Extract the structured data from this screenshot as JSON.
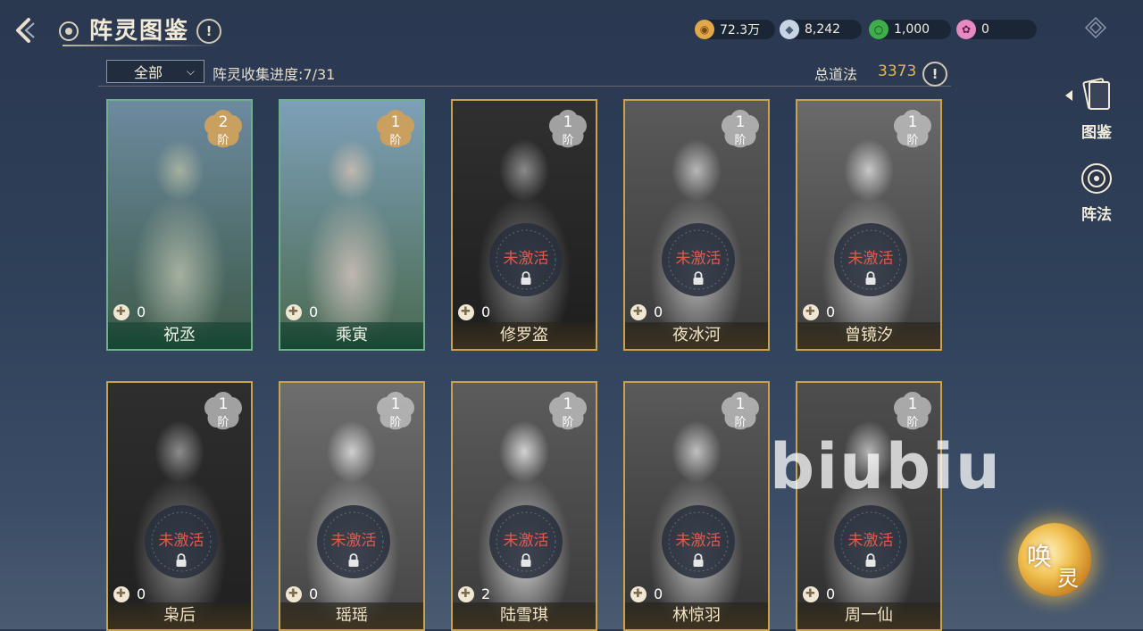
{
  "header": {
    "title": "阵灵图鉴",
    "help_label": "!"
  },
  "resources": [
    {
      "icon": "gold-coin-icon",
      "value": "72.3万",
      "color": "#e0a848"
    },
    {
      "icon": "silver-ingot-icon",
      "value": "8,242",
      "color": "#c6d4e4"
    },
    {
      "icon": "jade-ring-icon",
      "value": "1,000",
      "color": "#3fae4a"
    },
    {
      "icon": "pink-gem-icon",
      "value": "0",
      "color": "#e68ac4"
    }
  ],
  "filter": {
    "selected": "全部",
    "progress_label": "阵灵收集进度:",
    "progress_value": "7/31",
    "total_label": "总道法",
    "total_value": "3373"
  },
  "nav": {
    "items": [
      {
        "label": "图鉴",
        "icon": "card-book-icon",
        "active": true
      },
      {
        "label": "阵法",
        "icon": "formation-icon",
        "active": false
      }
    ]
  },
  "cards": [
    {
      "name": "祝丞",
      "rank": "2",
      "rank_unit": "阶",
      "fragments": "0",
      "activated": true
    },
    {
      "name": "乘寅",
      "rank": "1",
      "rank_unit": "阶",
      "fragments": "0",
      "activated": true
    },
    {
      "name": "修罗盗",
      "rank": "1",
      "rank_unit": "阶",
      "fragments": "0",
      "activated": false
    },
    {
      "name": "夜冰河",
      "rank": "1",
      "rank_unit": "阶",
      "fragments": "0",
      "activated": false
    },
    {
      "name": "曾镜汐",
      "rank": "1",
      "rank_unit": "阶",
      "fragments": "0",
      "activated": false
    },
    {
      "name": "枭后",
      "rank": "1",
      "rank_unit": "阶",
      "fragments": "0",
      "activated": false
    },
    {
      "name": "瑶瑶",
      "rank": "1",
      "rank_unit": "阶",
      "fragments": "0",
      "activated": false
    },
    {
      "name": "陆雪琪",
      "rank": "1",
      "rank_unit": "阶",
      "fragments": "2",
      "activated": false
    },
    {
      "name": "林惊羽",
      "rank": "1",
      "rank_unit": "阶",
      "fragments": "0",
      "activated": false
    },
    {
      "name": "周一仙",
      "rank": "1",
      "rank_unit": "阶",
      "fragments": "0",
      "activated": false
    }
  ],
  "locked_label": "未激活",
  "watermark": "biubiu",
  "summon": {
    "char1": "唤",
    "char2": "灵"
  }
}
